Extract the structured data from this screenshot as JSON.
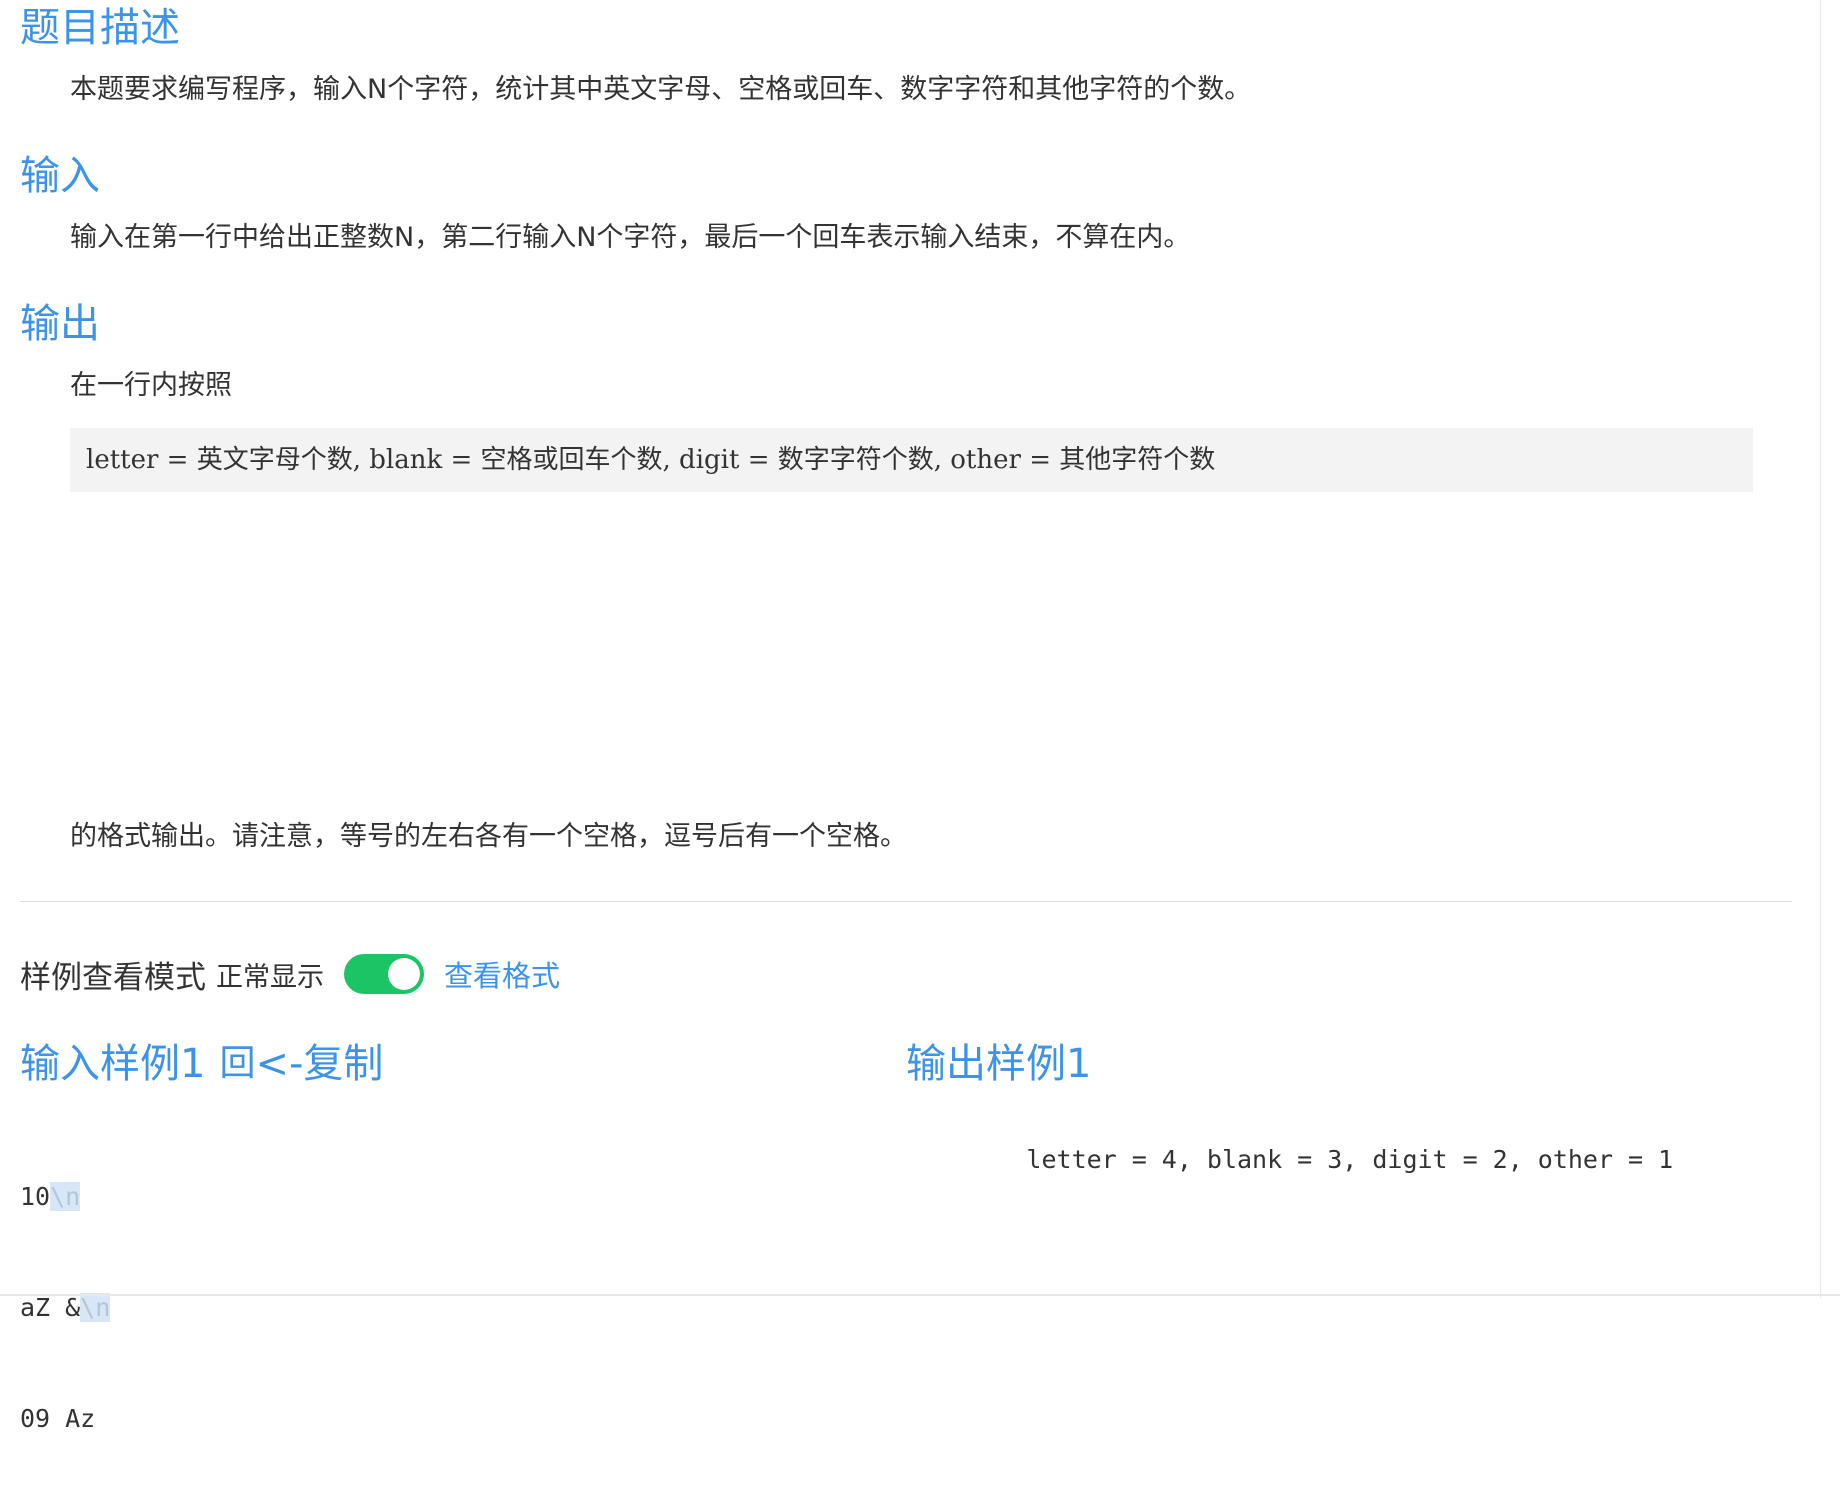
{
  "problem": {
    "description_heading": "题目描述",
    "description_text": "本题要求编写程序，输入N个字符，统计其中英文字母、空格或回车、数字字符和其他字符的个数。",
    "input_heading": "输入",
    "input_text": "输入在第一行中给出正整数N，第二行输入N个字符，最后一个回车表示输入结束，不算在内。",
    "output_heading": "输出",
    "output_text_before": "在一行内按照",
    "output_format_code": "letter = 英文字母个数, blank = 空格或回车个数, digit = 数字字符个数, other = 其他字符个数",
    "output_text_after": "的格式输出。请注意，等号的左右各有一个空格，逗号后有一个空格。"
  },
  "sample_mode": {
    "label": "样例查看模式",
    "status": "正常显示",
    "toggle_on": true,
    "toggle_color": "#1bc464",
    "view_format_link": "查看格式"
  },
  "input_sample": {
    "title": "输入样例1",
    "copy_icon": "copy-icon",
    "copy_label": "<-复制",
    "lines": [
      {
        "parts": [
          "10"
        ],
        "newline_marker": "\\n"
      },
      {
        "parts": [
          "aZ",
          "&"
        ],
        "newline_marker": "\\n"
      },
      {
        "parts": [
          "09",
          "Az"
        ],
        "newline_marker": ""
      }
    ]
  },
  "output_sample": {
    "title": "输出样例1",
    "tokens": [
      "letter",
      "=",
      "4,",
      "blank",
      "=",
      "3,",
      "digit",
      "=",
      "2,",
      "other",
      "=",
      "1"
    ]
  },
  "colors": {
    "heading_blue": "#3c93e8",
    "whitespace_highlight": "#d7e7f8"
  }
}
